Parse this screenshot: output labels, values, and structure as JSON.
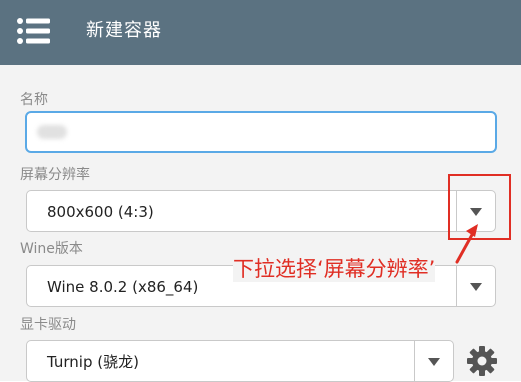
{
  "header": {
    "title": "新建容器",
    "menu_icon": "hamburger-menu-icon"
  },
  "form": {
    "name": {
      "label": "名称",
      "value": ""
    },
    "resolution": {
      "label": "屏幕分辨率",
      "value": "800x600 (4:3)"
    },
    "wine": {
      "label": "Wine版本",
      "value": "Wine 8.0.2 (x86_64)"
    },
    "gpu": {
      "label": "显卡驱动",
      "value": "Turnip (骁龙)",
      "settings_icon": "gear-icon"
    }
  },
  "annotation": {
    "text": "下拉选择‘屏幕分辨率’",
    "color": "#e02e24"
  },
  "colors": {
    "appbar": "#5b7281",
    "focus_border": "#5aa9e6",
    "background": "#f3f3f3"
  }
}
